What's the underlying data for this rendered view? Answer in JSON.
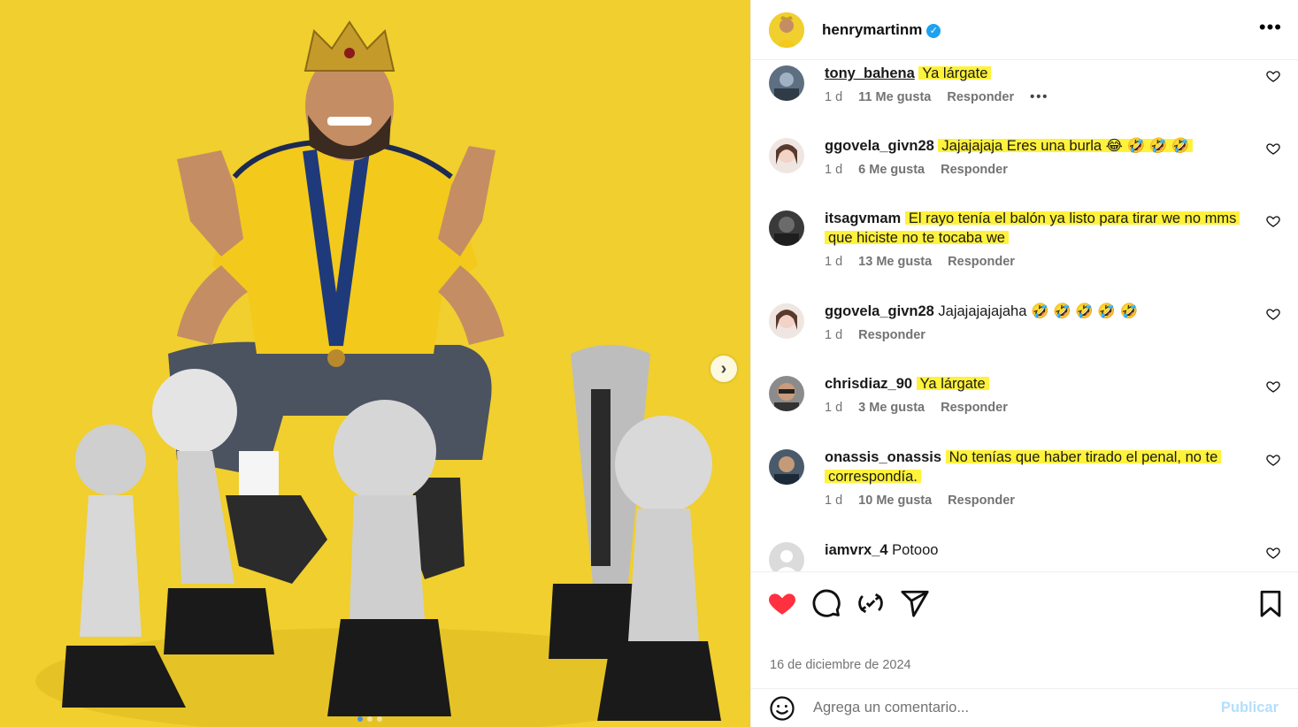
{
  "post": {
    "username": "henrymartinm",
    "verified": true,
    "date": "16 de diciembre de 2024",
    "photo_description": "Player in yellow jersey with crown and medal crouching behind five trophies on a yellow background",
    "carousel_dots": 3,
    "active_dot": 0
  },
  "comments": [
    {
      "user": "tony_bahena",
      "text": "Ya lárgate",
      "time": "1 d",
      "likes": "11 Me gusta",
      "reply": "Responder",
      "highlighted": true,
      "has_options": true
    },
    {
      "user": "ggovela_givn28",
      "text": "Jajajajaja Eres una burla 😂 🤣 🤣 🤣",
      "time": "1 d",
      "likes": "6 Me gusta",
      "reply": "Responder",
      "highlighted": true
    },
    {
      "user": "itsagvmam",
      "text_line1": "El rayo tenía el balón ya listo para tirar we no mms",
      "text_line2": "que hiciste no te tocaba we",
      "time": "1 d",
      "likes": "13 Me gusta",
      "reply": "Responder",
      "highlighted": true
    },
    {
      "user": "ggovela_givn28",
      "text": "Jajajajajajaha 🤣 🤣 🤣 🤣 🤣",
      "time": "1 d",
      "likes": "",
      "reply": "Responder",
      "highlighted": false
    },
    {
      "user": "chrisdiaz_90",
      "text": "Ya lárgate",
      "time": "1 d",
      "likes": "3 Me gusta",
      "reply": "Responder",
      "highlighted": true
    },
    {
      "user": "onassis_onassis",
      "text_line1": "No tenías que haber tirado el penal, no te",
      "text_line2": "correspondía.",
      "time": "1 d",
      "likes": "10 Me gusta",
      "reply": "Responder",
      "highlighted": true
    },
    {
      "user": "iamvrx_4",
      "text": "Potooo",
      "highlighted": false
    }
  ],
  "actions": {
    "like_icon": "heart-filled-icon",
    "comment_icon": "comment-icon",
    "repost_icon": "repost-icon",
    "share_icon": "share-icon",
    "save_icon": "bookmark-icon",
    "like_color": "#ff3040"
  },
  "composer": {
    "placeholder": "Agrega un comentario...",
    "publish_label": "Publicar",
    "emoji_icon": "emoji-icon"
  },
  "colors": {
    "highlight": "#fff23b",
    "background_yellow": "#f0cf2e",
    "verified_blue": "#1da1f2",
    "publish_disabled": "#b2dffc"
  }
}
